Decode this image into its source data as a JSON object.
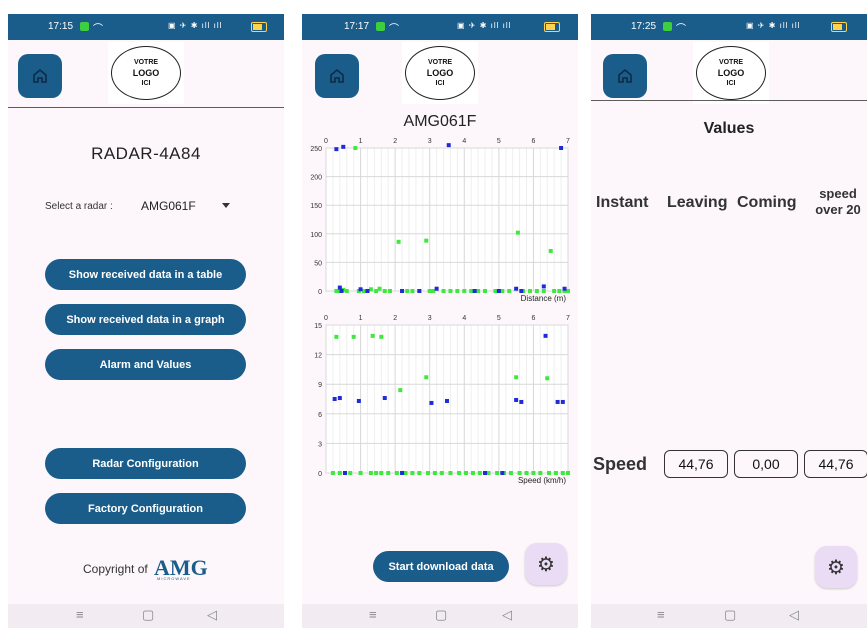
{
  "logo": {
    "line1": "VOTRE",
    "line2": "LOGO",
    "line3": "ICI"
  },
  "colors": {
    "primary": "#1a5d8b",
    "green_series": "#3ee83e",
    "blue_series": "#1f2bd6",
    "fab_bg": "#e9dcf4"
  },
  "icons": {
    "home": "home-icon",
    "settings": "gear-icon",
    "nav_menu": "menu-icon",
    "nav_home": "square-icon",
    "nav_back": "back-triangle-icon"
  },
  "screen1": {
    "time": "17:15",
    "radar_name": "RADAR-4A84",
    "select_label": "Select a radar :",
    "select_value": "AMG061F",
    "buttons": [
      "Show received data in a table",
      "Show received data in a graph",
      "Alarm and Values",
      "Radar Configuration",
      "Factory Configuration"
    ],
    "copyright_text": "Copyright of",
    "brand": "AMG",
    "brand_sub": "MICROWAVE"
  },
  "screen2": {
    "time": "17:17",
    "download_label": "Start download data"
  },
  "screen3": {
    "time": "17:25",
    "title": "Values",
    "headers": [
      "Instant",
      "Leaving",
      "Coming",
      "speed over 20"
    ],
    "row_label": "Speed",
    "values": [
      "44,76",
      "0,00",
      "44,76"
    ]
  },
  "chart_data": [
    {
      "type": "scatter",
      "title": "AMG061F",
      "xlabel": "Distance (m)",
      "ylabel": "",
      "xlim": [
        0,
        7
      ],
      "ylim": [
        0,
        250
      ],
      "x_ticks": [
        "0",
        "1",
        "2",
        "3",
        "4",
        "5",
        "6",
        "7"
      ],
      "y_ticks": [
        "0",
        "50",
        "100",
        "150",
        "200",
        "250"
      ],
      "grid": true,
      "series": [
        {
          "color": "green",
          "points": [
            [
              0.3,
              0
            ],
            [
              0.4,
              0
            ],
            [
              0.5,
              2
            ],
            [
              0.6,
              0
            ],
            [
              0.85,
              250
            ],
            [
              0.95,
              0
            ],
            [
              1.1,
              0
            ],
            [
              1.3,
              3
            ],
            [
              1.45,
              0
            ],
            [
              1.55,
              4
            ],
            [
              1.7,
              0
            ],
            [
              1.85,
              0
            ],
            [
              2.1,
              86
            ],
            [
              2.2,
              0
            ],
            [
              2.35,
              0
            ],
            [
              2.5,
              0
            ],
            [
              2.7,
              0
            ],
            [
              2.9,
              88
            ],
            [
              3.0,
              0
            ],
            [
              3.1,
              0
            ],
            [
              3.4,
              0
            ],
            [
              3.6,
              0
            ],
            [
              3.8,
              0
            ],
            [
              4.0,
              0
            ],
            [
              4.2,
              0
            ],
            [
              4.4,
              0
            ],
            [
              4.6,
              0
            ],
            [
              4.9,
              0
            ],
            [
              5.1,
              0
            ],
            [
              5.3,
              0
            ],
            [
              5.55,
              102
            ],
            [
              5.7,
              0
            ],
            [
              5.9,
              0
            ],
            [
              6.1,
              0
            ],
            [
              6.3,
              0
            ],
            [
              6.5,
              70
            ],
            [
              6.6,
              0
            ],
            [
              6.75,
              0
            ],
            [
              6.9,
              0
            ],
            [
              7.0,
              0
            ]
          ]
        },
        {
          "color": "blue",
          "points": [
            [
              0.3,
              248
            ],
            [
              0.4,
              6
            ],
            [
              0.45,
              0
            ],
            [
              0.5,
              252
            ],
            [
              1.0,
              3
            ],
            [
              1.2,
              0
            ],
            [
              2.2,
              0
            ],
            [
              2.7,
              0
            ],
            [
              3.2,
              4
            ],
            [
              3.55,
              255
            ],
            [
              4.3,
              0
            ],
            [
              5.0,
              0
            ],
            [
              5.5,
              4
            ],
            [
              5.65,
              0
            ],
            [
              6.3,
              8
            ],
            [
              6.8,
              250
            ],
            [
              6.9,
              4
            ]
          ]
        }
      ]
    },
    {
      "type": "scatter",
      "title": "",
      "xlabel": "Speed (km/h)",
      "ylabel": "",
      "xlim": [
        0,
        7
      ],
      "ylim": [
        0,
        15
      ],
      "x_ticks": [
        "0",
        "1",
        "2",
        "3",
        "4",
        "5",
        "6",
        "7"
      ],
      "y_ticks": [
        "0",
        "3",
        "6",
        "9",
        "12",
        "15"
      ],
      "grid": true,
      "series": [
        {
          "color": "green",
          "points": [
            [
              0.3,
              13.8
            ],
            [
              0.8,
              13.8
            ],
            [
              1.35,
              13.9
            ],
            [
              1.6,
              13.8
            ],
            [
              2.15,
              8.4
            ],
            [
              2.9,
              9.7
            ],
            [
              5.5,
              9.7
            ],
            [
              6.4,
              9.6
            ],
            [
              0.2,
              0
            ],
            [
              0.4,
              0
            ],
            [
              0.55,
              0
            ],
            [
              0.7,
              0
            ],
            [
              1.0,
              0
            ],
            [
              1.3,
              0
            ],
            [
              1.45,
              0
            ],
            [
              1.6,
              0
            ],
            [
              1.8,
              0
            ],
            [
              2.05,
              0
            ],
            [
              2.3,
              0
            ],
            [
              2.5,
              0
            ],
            [
              2.7,
              0
            ],
            [
              2.95,
              0
            ],
            [
              3.15,
              0
            ],
            [
              3.35,
              0
            ],
            [
              3.6,
              0
            ],
            [
              3.85,
              0
            ],
            [
              4.05,
              0
            ],
            [
              4.25,
              0
            ],
            [
              4.45,
              0
            ],
            [
              4.7,
              0
            ],
            [
              4.95,
              0
            ],
            [
              5.15,
              0
            ],
            [
              5.35,
              0
            ],
            [
              5.6,
              0
            ],
            [
              5.8,
              0
            ],
            [
              6.0,
              0
            ],
            [
              6.2,
              0
            ],
            [
              6.45,
              0
            ],
            [
              6.65,
              0
            ],
            [
              6.85,
              0
            ],
            [
              7.0,
              0
            ]
          ]
        },
        {
          "color": "blue",
          "points": [
            [
              0.25,
              7.5
            ],
            [
              0.4,
              7.6
            ],
            [
              0.55,
              0
            ],
            [
              0.95,
              7.3
            ],
            [
              1.7,
              7.6
            ],
            [
              2.2,
              0
            ],
            [
              3.05,
              7.1
            ],
            [
              3.5,
              7.3
            ],
            [
              4.6,
              0
            ],
            [
              5.5,
              7.4
            ],
            [
              5.65,
              7.2
            ],
            [
              6.35,
              13.9
            ],
            [
              6.7,
              7.2
            ],
            [
              6.85,
              7.2
            ],
            [
              5.1,
              0
            ]
          ]
        }
      ]
    }
  ]
}
